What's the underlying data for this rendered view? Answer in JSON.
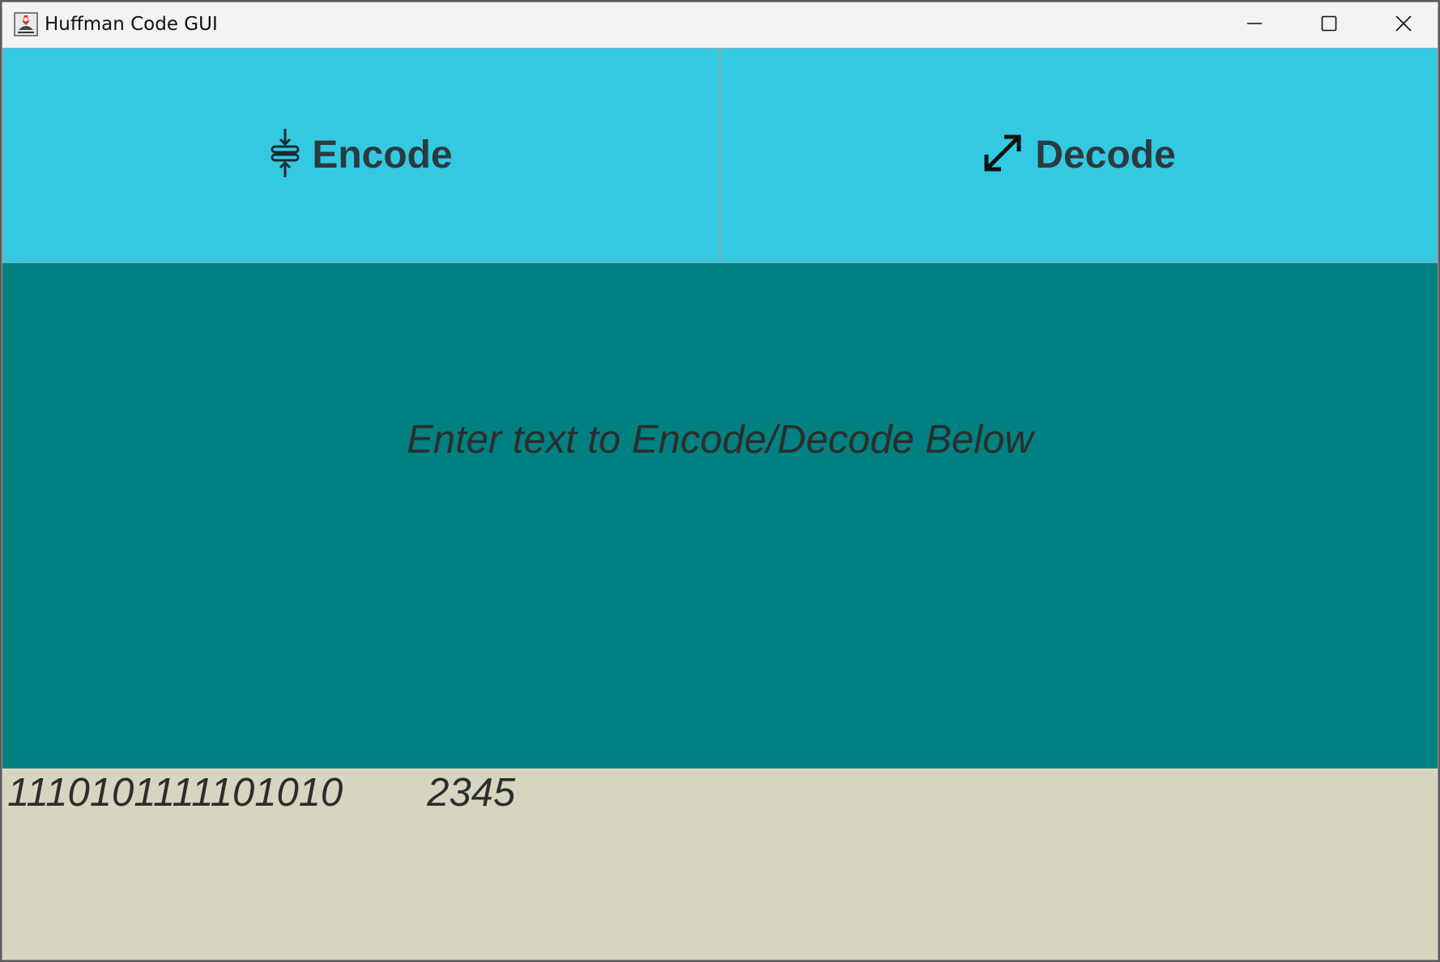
{
  "window": {
    "title": "Huffman Code GUI",
    "icon": "java-app-icon"
  },
  "controls": {
    "minimize": "minimize-icon",
    "maximize": "maximize-icon",
    "close": "close-icon"
  },
  "actions": {
    "encode": {
      "label": "Encode",
      "icon": "compress-icon"
    },
    "decode": {
      "label": "Decode",
      "icon": "expand-icon"
    }
  },
  "prompt": {
    "text": "Enter text to Encode/Decode Below"
  },
  "io": {
    "encoded_output": "1110101111101010",
    "input_text": "2345"
  },
  "colors": {
    "button_bg": "#33cae1",
    "prompt_bg": "#008080",
    "io_bg": "#d6d5c0",
    "text": "#2d2d2d"
  }
}
